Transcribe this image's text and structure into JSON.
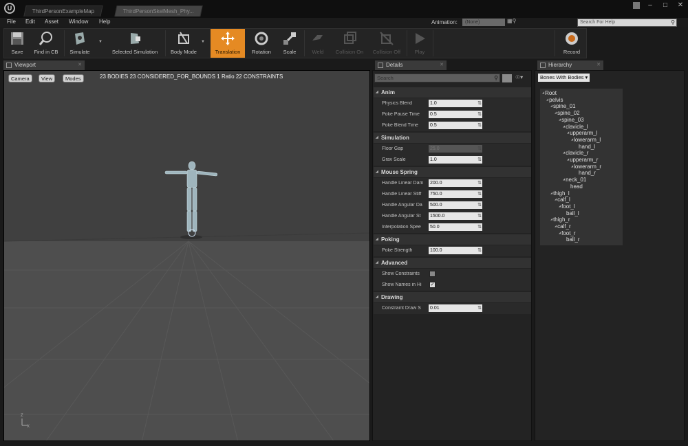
{
  "title_bar": {
    "tabs": [
      "ThirdPersonExampleMap",
      "ThirdPersonSkelMesh_Phy..."
    ]
  },
  "menu": [
    "File",
    "Edit",
    "Asset",
    "Window",
    "Help"
  ],
  "help_search_placeholder": "Search For Help",
  "toolbar": {
    "buttons": [
      {
        "label": "Save",
        "icon": "save-icon"
      },
      {
        "label": "Find in CB",
        "icon": "find-in-cb-icon"
      },
      {
        "label": "Simulate",
        "icon": "simulate-icon"
      },
      {
        "label": "Selected Simulation",
        "icon": "selected-simulation-icon"
      },
      {
        "label": "Body Mode",
        "icon": "body-mode-icon"
      },
      {
        "label": "Translation",
        "icon": "translation-icon"
      },
      {
        "label": "Rotation",
        "icon": "rotation-icon"
      },
      {
        "label": "Scale",
        "icon": "scale-icon"
      },
      {
        "label": "Weld",
        "icon": "weld-icon"
      },
      {
        "label": "Collision On",
        "icon": "collision-on-icon"
      },
      {
        "label": "Collision Off",
        "icon": "collision-off-icon"
      },
      {
        "label": "Play",
        "icon": "play-icon"
      },
      {
        "label": "Record",
        "icon": "record-icon"
      }
    ],
    "animation_label": "Animation:",
    "animation_value": "(None)",
    "accent_color": "#e58a23"
  },
  "viewport": {
    "tab": "Viewport",
    "buttons": [
      "Camera",
      "View",
      "Modes"
    ],
    "stats": "23 BODIES 23 CONSIDERED_FOR_BOUNDS 1 Ratio 22 CONSTRAINTS",
    "axis_z": "Z",
    "axis_x": "X"
  },
  "details": {
    "tab": "Details",
    "search_placeholder": "Search",
    "categories": [
      {
        "title": "Anim",
        "props": [
          {
            "label": "Physics Blend",
            "value": "1.0"
          },
          {
            "label": "Poke Pause Time",
            "value": "0.5"
          },
          {
            "label": "Poke Blend Time",
            "value": "0.5"
          }
        ]
      },
      {
        "title": "Simulation",
        "props": [
          {
            "label": "Floor Gap",
            "value": "25.0",
            "disabled": true
          },
          {
            "label": "Grav Scale",
            "value": "1.0"
          }
        ]
      },
      {
        "title": "Mouse Spring",
        "props": [
          {
            "label": "Handle Linear Dam",
            "value": "200.0"
          },
          {
            "label": "Handle Linear Stiff",
            "value": "750.0"
          },
          {
            "label": "Handle Angular Da",
            "value": "500.0"
          },
          {
            "label": "Handle Angular St",
            "value": "1500.0"
          },
          {
            "label": "Interpolation Spee",
            "value": "50.0"
          }
        ]
      },
      {
        "title": "Poking",
        "props": [
          {
            "label": "Poke Strength",
            "value": "100.0"
          }
        ]
      },
      {
        "title": "Advanced",
        "props": [
          {
            "label": "Show Constraints",
            "checkbox": true,
            "checked": false
          },
          {
            "label": "Show Names in Hi",
            "checkbox": true,
            "checked": true
          }
        ]
      },
      {
        "title": "Drawing",
        "props": [
          {
            "label": "Constraint Draw S",
            "value": "0.01"
          }
        ]
      }
    ]
  },
  "hierarchy": {
    "tab": "Hierarchy",
    "filter": "Bones With Bodies",
    "bones": [
      {
        "name": "Root",
        "depth": 0,
        "parent": true
      },
      {
        "name": "pelvis",
        "depth": 1,
        "parent": true
      },
      {
        "name": "spine_01",
        "depth": 2,
        "parent": true
      },
      {
        "name": "spine_02",
        "depth": 3,
        "parent": true
      },
      {
        "name": "spine_03",
        "depth": 4,
        "parent": true
      },
      {
        "name": "clavicle_l",
        "depth": 5,
        "parent": true
      },
      {
        "name": "upperarm_l",
        "depth": 6,
        "parent": true
      },
      {
        "name": "lowerarm_l",
        "depth": 7,
        "parent": true
      },
      {
        "name": "hand_l",
        "depth": 8,
        "parent": false
      },
      {
        "name": "clavicle_r",
        "depth": 5,
        "parent": true
      },
      {
        "name": "upperarm_r",
        "depth": 6,
        "parent": true
      },
      {
        "name": "lowerarm_r",
        "depth": 7,
        "parent": true
      },
      {
        "name": "hand_r",
        "depth": 8,
        "parent": false
      },
      {
        "name": "neck_01",
        "depth": 5,
        "parent": true
      },
      {
        "name": "head",
        "depth": 6,
        "parent": false
      },
      {
        "name": "thigh_l",
        "depth": 2,
        "parent": true
      },
      {
        "name": "calf_l",
        "depth": 3,
        "parent": true
      },
      {
        "name": "foot_l",
        "depth": 4,
        "parent": true
      },
      {
        "name": "ball_l",
        "depth": 5,
        "parent": false
      },
      {
        "name": "thigh_r",
        "depth": 2,
        "parent": true
      },
      {
        "name": "calf_r",
        "depth": 3,
        "parent": true
      },
      {
        "name": "foot_r",
        "depth": 4,
        "parent": true
      },
      {
        "name": "ball_r",
        "depth": 5,
        "parent": false
      }
    ]
  }
}
